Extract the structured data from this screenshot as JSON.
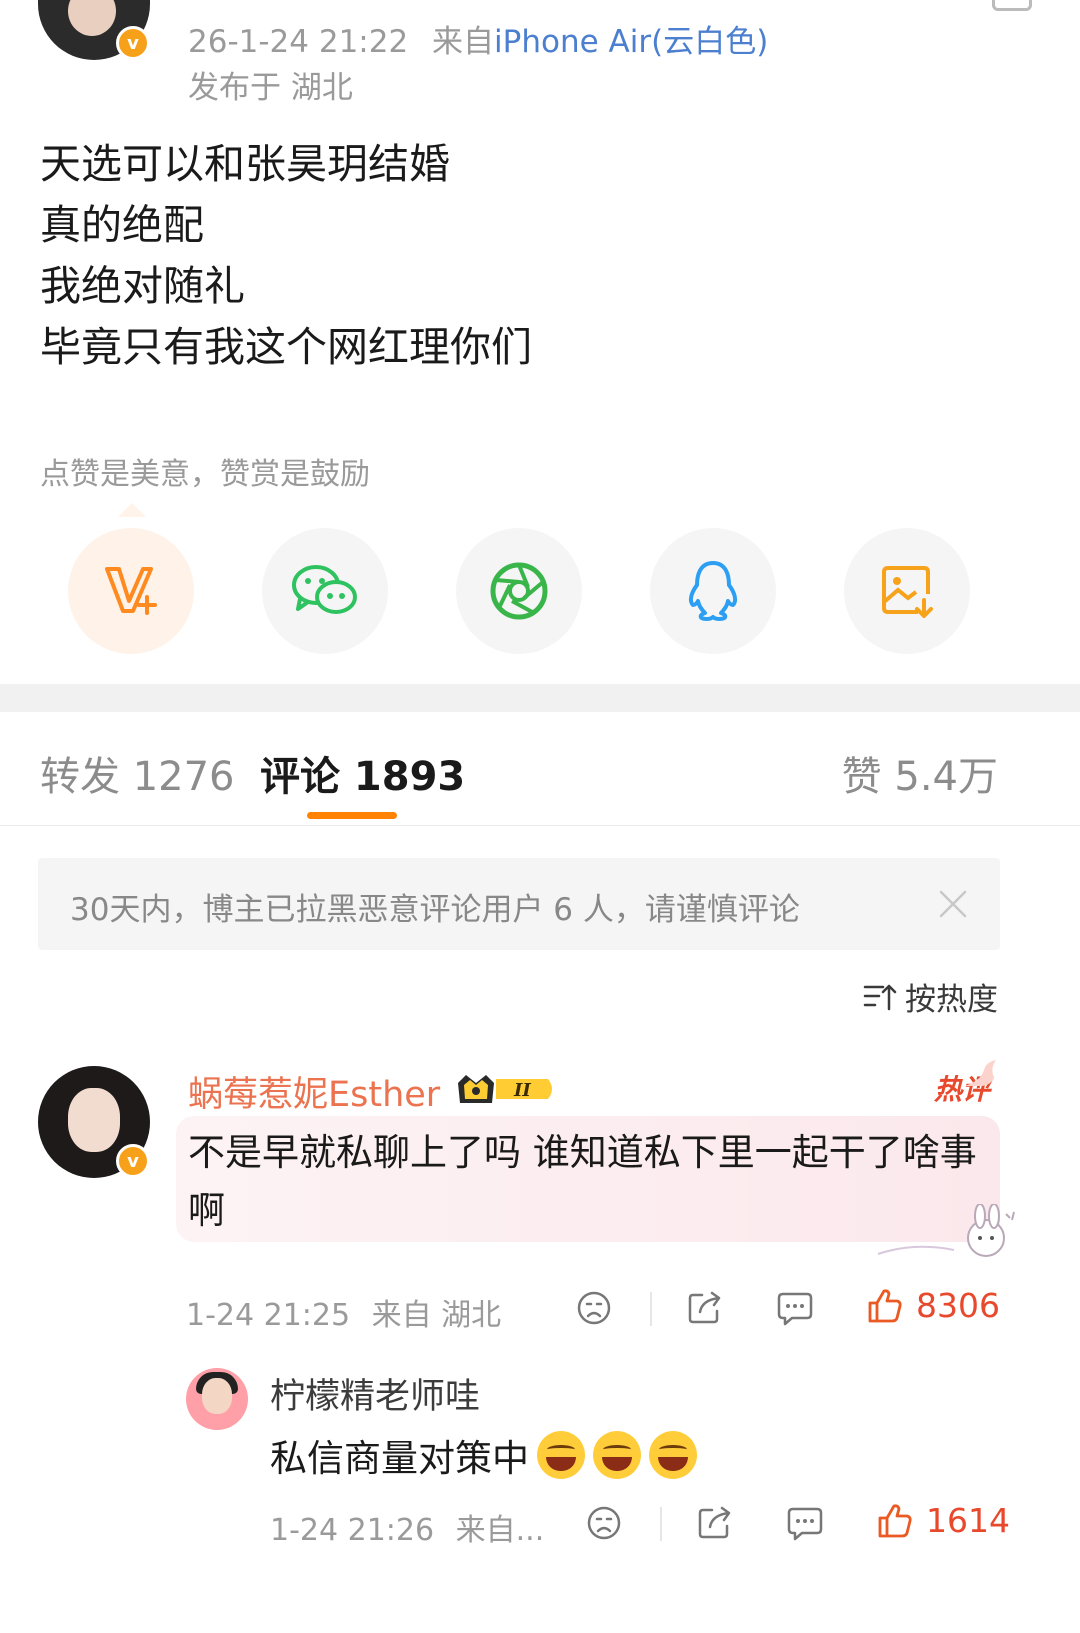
{
  "post": {
    "timestamp": "26-1-24 21:22",
    "source_prefix": "来自",
    "device": "iPhone Air(云白色)",
    "location": "发布于 湖北",
    "body_lines": [
      "天选可以和张昊玥结婚",
      "真的绝配",
      "我绝对随礼",
      "毕竟只有我这个网红理你们"
    ],
    "reward_hint": "点赞是美意，赞赏是鼓励",
    "share_icons": [
      "v-plus-icon",
      "wechat-icon",
      "moments-icon",
      "qq-icon",
      "save-image-icon"
    ]
  },
  "tabs": {
    "repost": "转发 1276",
    "comments": "评论 1893",
    "likes": "赞 5.4万"
  },
  "notice": {
    "text": "30天内，博主已拉黑恶意评论用户 6 人，请谨慎评论"
  },
  "sort": {
    "label": "按热度"
  },
  "comment": {
    "author": "蜗莓惹妮Esther",
    "level_badge": "II",
    "hot_tag": "热评",
    "text": "不是早就私聊上了吗 谁知道私下里一起干了啥事啊",
    "time": "1-24 21:25",
    "source": "来自 湖北",
    "likes": "8306"
  },
  "reply": {
    "author": "柠檬精老师哇",
    "text": "私信商量对策中",
    "emoji_count": 3,
    "time": "1-24 21:26",
    "source": "来自...",
    "likes": "1614"
  },
  "colors": {
    "accent_orange": "#ff8200",
    "like_red": "#e8492d",
    "link_blue": "#4c7fcf",
    "username_orange": "#eb7350"
  }
}
